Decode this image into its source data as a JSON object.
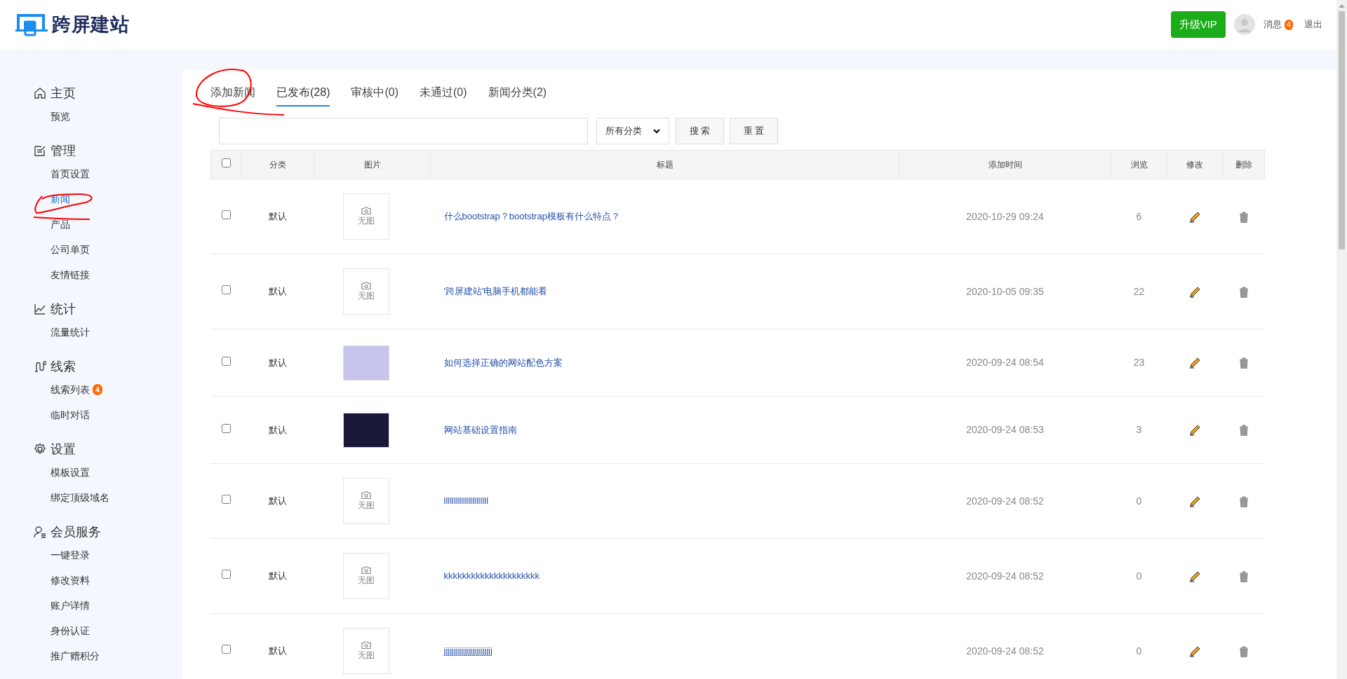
{
  "header": {
    "logo_text": "跨屏建站",
    "upgrade_button": "升级VIP",
    "messages": {
      "label": "消息",
      "count": "4"
    },
    "logout": "退出"
  },
  "sidebar": {
    "groups": [
      {
        "kind": "home",
        "title": "主页",
        "items": [
          {
            "label": "预览",
            "selected": false
          }
        ]
      },
      {
        "kind": "manage",
        "title": "管理",
        "items": [
          {
            "label": "首页设置",
            "selected": false
          },
          {
            "label": "新闻",
            "selected": true
          },
          {
            "label": "产品",
            "selected": false
          },
          {
            "label": "公司单页",
            "selected": false
          },
          {
            "label": "友情链接",
            "selected": false
          }
        ]
      },
      {
        "kind": "stats",
        "title": "统计",
        "items": [
          {
            "label": "流量统计",
            "selected": false
          }
        ]
      },
      {
        "kind": "leads",
        "title": "线索",
        "items": [
          {
            "label": "线索列表",
            "selected": false,
            "badge": "4"
          },
          {
            "label": "临时对话",
            "selected": false
          }
        ]
      },
      {
        "kind": "settings",
        "title": "设置",
        "items": [
          {
            "label": "模板设置",
            "selected": false
          },
          {
            "label": "绑定顶级域名",
            "selected": false
          }
        ]
      },
      {
        "kind": "member",
        "title": "会员服务",
        "items": [
          {
            "label": "一键登录",
            "selected": false
          },
          {
            "label": "修改资料",
            "selected": false
          },
          {
            "label": "账户详情",
            "selected": false
          },
          {
            "label": "身份认证",
            "selected": false
          },
          {
            "label": "推广赠积分",
            "selected": false
          }
        ]
      }
    ]
  },
  "tabs": [
    {
      "label": "添加新闻",
      "selected": false
    },
    {
      "label": "已发布(28)",
      "selected": true
    },
    {
      "label": "审核中(0)",
      "selected": false
    },
    {
      "label": "未通过(0)",
      "selected": false
    },
    {
      "label": "新闻分类(2)",
      "selected": false
    }
  ],
  "filter": {
    "category_select": "所有分类",
    "search_button": "搜 索",
    "reset_button": "重 置"
  },
  "table": {
    "select_all": {
      "checked": false
    },
    "columns": [
      "分类",
      "图片",
      "标题",
      "添加时间",
      "浏览",
      "修改",
      "删除"
    ],
    "rows": [
      {
        "checked": false,
        "category": "默认",
        "image": {
          "kind": "none",
          "label": "无图"
        },
        "title": "什么bootstrap？bootstrap模板有什么特点？",
        "time": "2020-10-29 09:24",
        "views": "6"
      },
      {
        "checked": false,
        "category": "默认",
        "image": {
          "kind": "none",
          "label": "无图"
        },
        "title": "'跨屏建站'电脑手机都能看",
        "time": "2020-10-05 09:35",
        "views": "22"
      },
      {
        "checked": false,
        "category": "默认",
        "image": {
          "kind": "photo"
        },
        "title": "如何选择正确的网站配色方案",
        "time": "2020-09-24 08:54",
        "views": "23"
      },
      {
        "checked": false,
        "category": "默认",
        "image": {
          "kind": "photo"
        },
        "title": "网站基础设置指南",
        "time": "2020-09-24 08:53",
        "views": "3"
      },
      {
        "checked": false,
        "category": "默认",
        "image": {
          "kind": "none",
          "label": "无图"
        },
        "title": "llllllllllllllllllllll",
        "time": "2020-09-24 08:52",
        "views": "0"
      },
      {
        "checked": false,
        "category": "默认",
        "image": {
          "kind": "none",
          "label": "无图"
        },
        "title": "kkkkkkkkkkkkkkkkkkkkk",
        "time": "2020-09-24 08:52",
        "views": "0"
      },
      {
        "checked": false,
        "category": "默认",
        "image": {
          "kind": "none",
          "label": "无图"
        },
        "title": "jjjjjjjjjjjjjjjjjjjjjjjj",
        "time": "2020-09-24 08:52",
        "views": "0"
      }
    ]
  }
}
